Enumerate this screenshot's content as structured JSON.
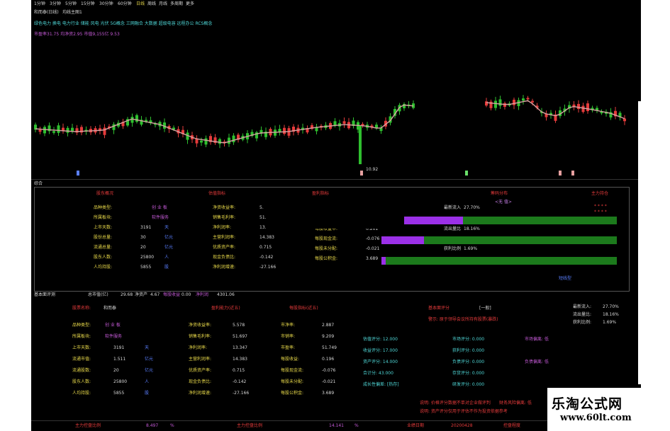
{
  "toolbar": {
    "periods": [
      "1分钟",
      "3分钟",
      "5分钟",
      "15分钟",
      "30分钟",
      "60分钟",
      "日线",
      "周线",
      "月线",
      "多周期",
      "更多"
    ]
  },
  "chart_header": {
    "title": "和而泰(日线)",
    "indicator": "均线主图1",
    "concepts": "绿色电力 换电 电力行业 储能 风电 光伏 5G概念 三网融合 大数据 超级电容 远程办公 RCS概念",
    "stats": "市盈率31.75 均净资2.95 市值9,155亿 9.53"
  },
  "price_chart": {
    "low_label": "10.92"
  },
  "panel1": {
    "title": "综合",
    "headers": [
      "股东概况",
      "估值指标",
      "盈利指标",
      "筹码分布",
      "主力持仓"
    ],
    "left_labels": [
      "品种类型:",
      "所属板块:",
      "上市天数:",
      "股份总量:",
      "流通总量:",
      "股东人数:",
      "人均持股:"
    ],
    "left_values": [
      "创 业 板",
      "软件服务",
      "3191",
      "30",
      "20",
      "25800",
      "5855"
    ],
    "left_units": [
      "",
      "",
      "天",
      "亿元",
      "亿元",
      "人",
      "股"
    ],
    "mid_labels": [
      "净资收益率:",
      "销售毛利率:",
      "净利润率:",
      "主营利润率:",
      "优质资产率:",
      "现金负债比:",
      "净利润增速:"
    ],
    "mid_values": [
      "5.",
      "51.",
      "13.",
      "14.383",
      "0.715",
      "-0.142",
      "-27.166"
    ],
    "right_labels": [
      "每股收益率:",
      "每股现金流:",
      "每股未分配:",
      "每股公积金:"
    ],
    "right_values": [
      "0.196",
      "0.261",
      "-0.076",
      "-0.021",
      "3.689"
    ],
    "ratios": [
      {
        "label": "最新流入",
        "value": "27.70%",
        "fill": 0.277
      },
      {
        "label": "流出量比",
        "value": "18.16%",
        "fill": 0.1816
      },
      {
        "label": "获利比例",
        "value": "1.69%",
        "fill": 0.0169
      }
    ],
    "badge": "<无 值>",
    "foot": "短线型",
    "stars": "* * * *"
  },
  "panel2_head": {
    "title": "基本面评测",
    "cap": "总市值(亿)",
    "cap_value": "29.68",
    "nav": "净资产",
    "nav_value": "4.67",
    "extra1": "每股收益",
    "extra1_value": "0.00",
    "extra2": "净利润",
    "extra2_value": "4301.06"
  },
  "panel2": {
    "stock_label": "股票名称:",
    "stock_name": "和而泰",
    "section_headers": [
      "盈利能力(近五)",
      "每股指标(近五)",
      "基本面评分",
      "[一般]"
    ],
    "left_labels": [
      "品种类型:",
      "所属板块:",
      "上市天数:",
      "流通市值:",
      "流通股数:",
      "股东人数:",
      "人均持股:"
    ],
    "left_values": [
      "创 业 板",
      "软件服务",
      "3191",
      "1.511",
      "20",
      "25800",
      "5855"
    ],
    "left_units": [
      "",
      "",
      "天",
      "亿元",
      "亿元",
      "人",
      "股"
    ],
    "mid_labels": [
      "净资收益率:",
      "销售毛利率:",
      "净利润率:",
      "主营利润率:",
      "优质资产率:",
      "现金负债比:",
      "净利润增速:"
    ],
    "mid_values": [
      "5.578",
      "51.697",
      "13.347",
      "14.383",
      "0.715",
      "-0.142",
      "-27.166"
    ],
    "right_labels": [
      "市净率:",
      "市销率:",
      "市盈率:",
      "每股收益:",
      "每股现金流:",
      "每股未分配:",
      "每股公积金:"
    ],
    "right_values": [
      "2.887",
      "9.209",
      "51.749",
      "0.196",
      "-0.076",
      "-0.021",
      "3.689"
    ],
    "note": "警示: 原于领导会议所持有股票(暴跌)",
    "scores": [
      "估值评分: 12.000",
      "收益评分: 17.000",
      "资产评分: 14.000",
      "合计分: 43.000",
      "成长性偏差: [热存]"
    ],
    "scores_r": [
      "市场评分: 0.000",
      "获利评分: 0.000",
      "负债评分: 0.000",
      "存货评分: 0.000",
      "研发评分: 0.000"
    ],
    "side": [
      "市场偏离: 低",
      "负债偏离: 低"
    ],
    "ratios": [
      {
        "label": "最新流入:",
        "value": "27.70%"
      },
      {
        "label": "流出量比:",
        "value": "18.16%"
      },
      {
        "label": "获利比例:",
        "value": "1.69%"
      }
    ],
    "remark1": "说明: 价格评分数据不单对企业做评判",
    "remark2": "说明: 资产评分仅用于评估不作为投资依据参考",
    "remark3": "财务风险偏离: 低"
  },
  "bottom": {
    "a_label": "主力控盘比例",
    "a_value": "8.497",
    "a_unit": "%",
    "b_label": "主力控盘比例",
    "b_value": "14.141",
    "b_unit": "%",
    "c_label": "业绩日期",
    "c_value": "20200428",
    "d_label": "控盘程度"
  },
  "watermark": {
    "cn": "乐淘公式网",
    "url": "www.60lt.com"
  },
  "colors": {
    "up": "#e53b3b",
    "down": "#2fbf2f",
    "ma": "#d8a3a3",
    "purple": "#9b30e8",
    "green_bar": "#1c7a1c"
  }
}
